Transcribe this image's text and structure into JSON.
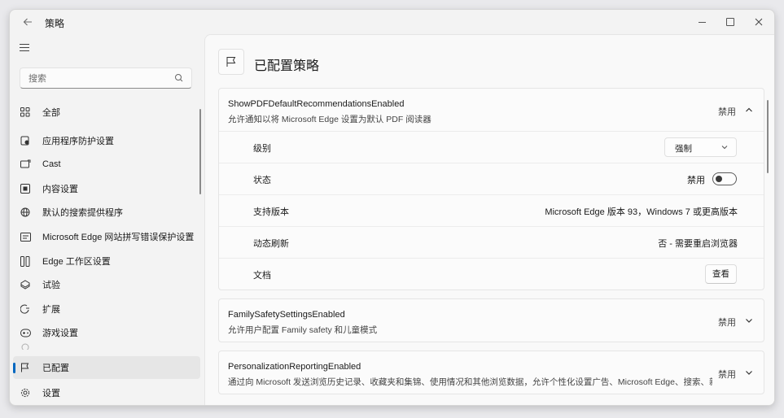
{
  "window": {
    "title": "策略",
    "back_icon": "arrow-left-icon"
  },
  "sidebar": {
    "search_placeholder": "搜索",
    "items": [
      {
        "label": "全部",
        "icon": "grid-icon"
      },
      {
        "label": "应用程序防护设置",
        "icon": "app-guard-icon"
      },
      {
        "label": "Cast",
        "icon": "cast-icon"
      },
      {
        "label": "内容设置",
        "icon": "content-settings-icon"
      },
      {
        "label": "默认的搜索提供程序",
        "icon": "globe-icon"
      },
      {
        "label": "Microsoft Edge 网站拼写错误保护设置",
        "icon": "typo-protection-icon"
      },
      {
        "label": "Edge 工作区设置",
        "icon": "workspace-icon"
      },
      {
        "label": "试验",
        "icon": "beaker-icon"
      },
      {
        "label": "扩展",
        "icon": "puzzle-icon"
      },
      {
        "label": "游戏设置",
        "icon": "gamepad-icon"
      },
      {
        "label": "已配置",
        "icon": "flag-icon",
        "active": true
      },
      {
        "label": "设置",
        "icon": "gear-icon"
      }
    ]
  },
  "main": {
    "page_title": "已配置策略",
    "cards": [
      {
        "name": "ShowPDFDefaultRecommendationsEnabled",
        "description": "允许通知以将 Microsoft Edge 设置为默认 PDF 阅读器",
        "status": "禁用",
        "expanded": true,
        "rows": {
          "level_label": "级别",
          "level_value": "强制",
          "state_label": "状态",
          "state_value": "禁用",
          "version_label": "支持版本",
          "version_value": "Microsoft Edge 版本 93，Windows 7 或更高版本",
          "refresh_label": "动态刷新",
          "refresh_value": "否 - 需要重启浏览器",
          "docs_label": "文档",
          "docs_button": "查看"
        }
      },
      {
        "name": "FamilySafetySettingsEnabled",
        "description": "允许用户配置 Family safety 和儿童模式",
        "status": "禁用",
        "expanded": false
      },
      {
        "name": "PersonalizationReportingEnabled",
        "description": "通过向 Microsoft 发送浏览历史记录、收藏夹和集锦、使用情况和其他浏览数据，允许个性化设置广告、Microsoft Edge、搜索、新闻和其他 Microsoft 服务",
        "status": "禁用",
        "expanded": false
      }
    ]
  }
}
